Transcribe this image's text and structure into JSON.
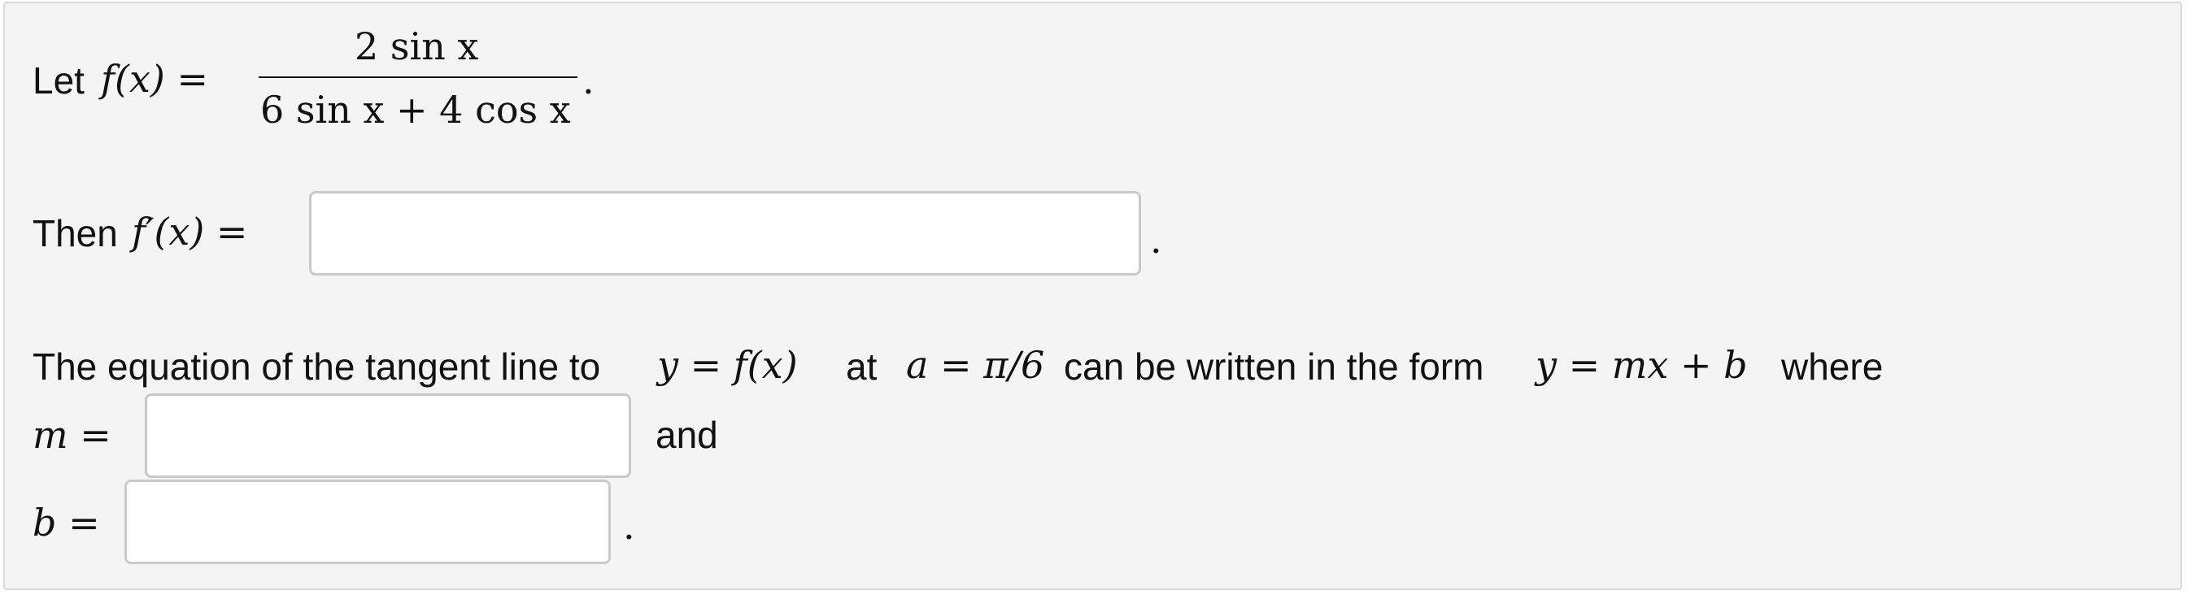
{
  "problem": {
    "let_word": "Let",
    "fx": "f(x) =",
    "numerator": "2 sin x",
    "denominator": "6 sin x + 4 cos x",
    "period1": ".",
    "then_word": "Then",
    "fprime": "f′(x) =",
    "period2": ".",
    "sentence_part1": "The equation of the tangent line to",
    "y_eq_fx": "y = f(x)",
    "at_word": "at",
    "a_eq": "a = π/6",
    "sentence_part2": "can be written in the form",
    "y_eq_mxb": "y = mx + b",
    "where_word": "where",
    "m_eq": "m =",
    "and_word": "and",
    "b_eq": "b =",
    "period3": "."
  },
  "answers": {
    "derivative_value": "",
    "m_value": "",
    "b_value": ""
  }
}
